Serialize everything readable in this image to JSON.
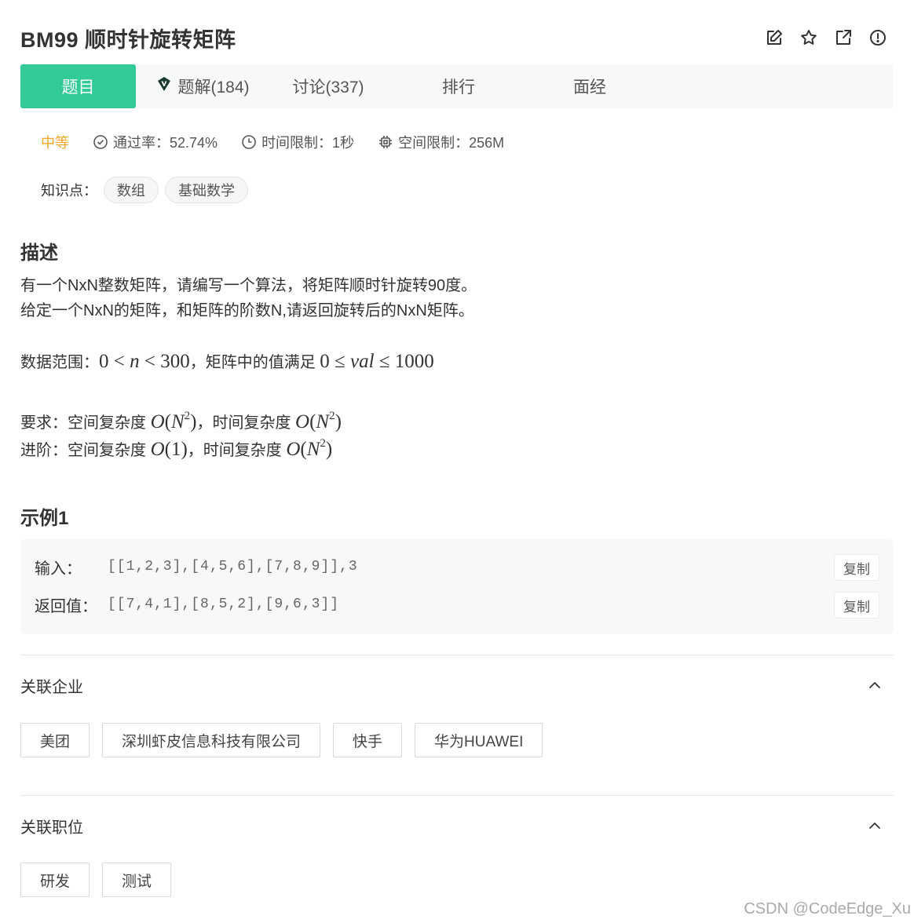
{
  "problem": {
    "title": "BM99  顺时针旋转矩阵"
  },
  "header_icons": [
    "edit-icon",
    "star-icon",
    "share-icon",
    "report-icon"
  ],
  "tabs": {
    "problem": "题目",
    "solutions": "题解(184)",
    "discussion": "讨论(337)",
    "ranking": "排行",
    "interview": "面经"
  },
  "meta": {
    "difficulty": "中等",
    "pass_rate": "通过率：52.74%",
    "time_limit": "时间限制：1秒",
    "space_limit": "空间限制：256M"
  },
  "knowledge": {
    "label": "知识点：",
    "tags": [
      "数组",
      "基础数学"
    ]
  },
  "description": {
    "heading": "描述",
    "line1": "有一个NxN整数矩阵，请编写一个算法，将矩阵顺时针旋转90度。",
    "line2": "给定一个NxN的矩阵，和矩阵的阶数N,请返回旋转后的NxN矩阵。",
    "range_prefix": "数据范围：",
    "range_mid": "，矩阵中的值满足 ",
    "req_prefix": "要求：空间复杂度 ",
    "req_mid": "，时间复杂度 ",
    "adv_prefix": "进阶：空间复杂度 ",
    "adv_mid": "，时间复杂度 "
  },
  "example": {
    "heading": "示例1",
    "input_label": "输入：",
    "input_value": "[[1,2,3],[4,5,6],[7,8,9]],3",
    "output_label": "返回值：",
    "output_value": "[[7,4,1],[8,5,2],[9,6,3]]",
    "copy_label": "复制"
  },
  "companies": {
    "heading": "关联企业",
    "items": [
      "美团",
      "深圳虾皮信息科技有限公司",
      "快手",
      "华为HUAWEI"
    ]
  },
  "positions": {
    "heading": "关联职位",
    "items": [
      "研发",
      "测试"
    ]
  },
  "watermark": "CSDN @CodeEdge_Xu",
  "colors": {
    "accent": "#32ca99",
    "difficulty": "#f5a623"
  }
}
